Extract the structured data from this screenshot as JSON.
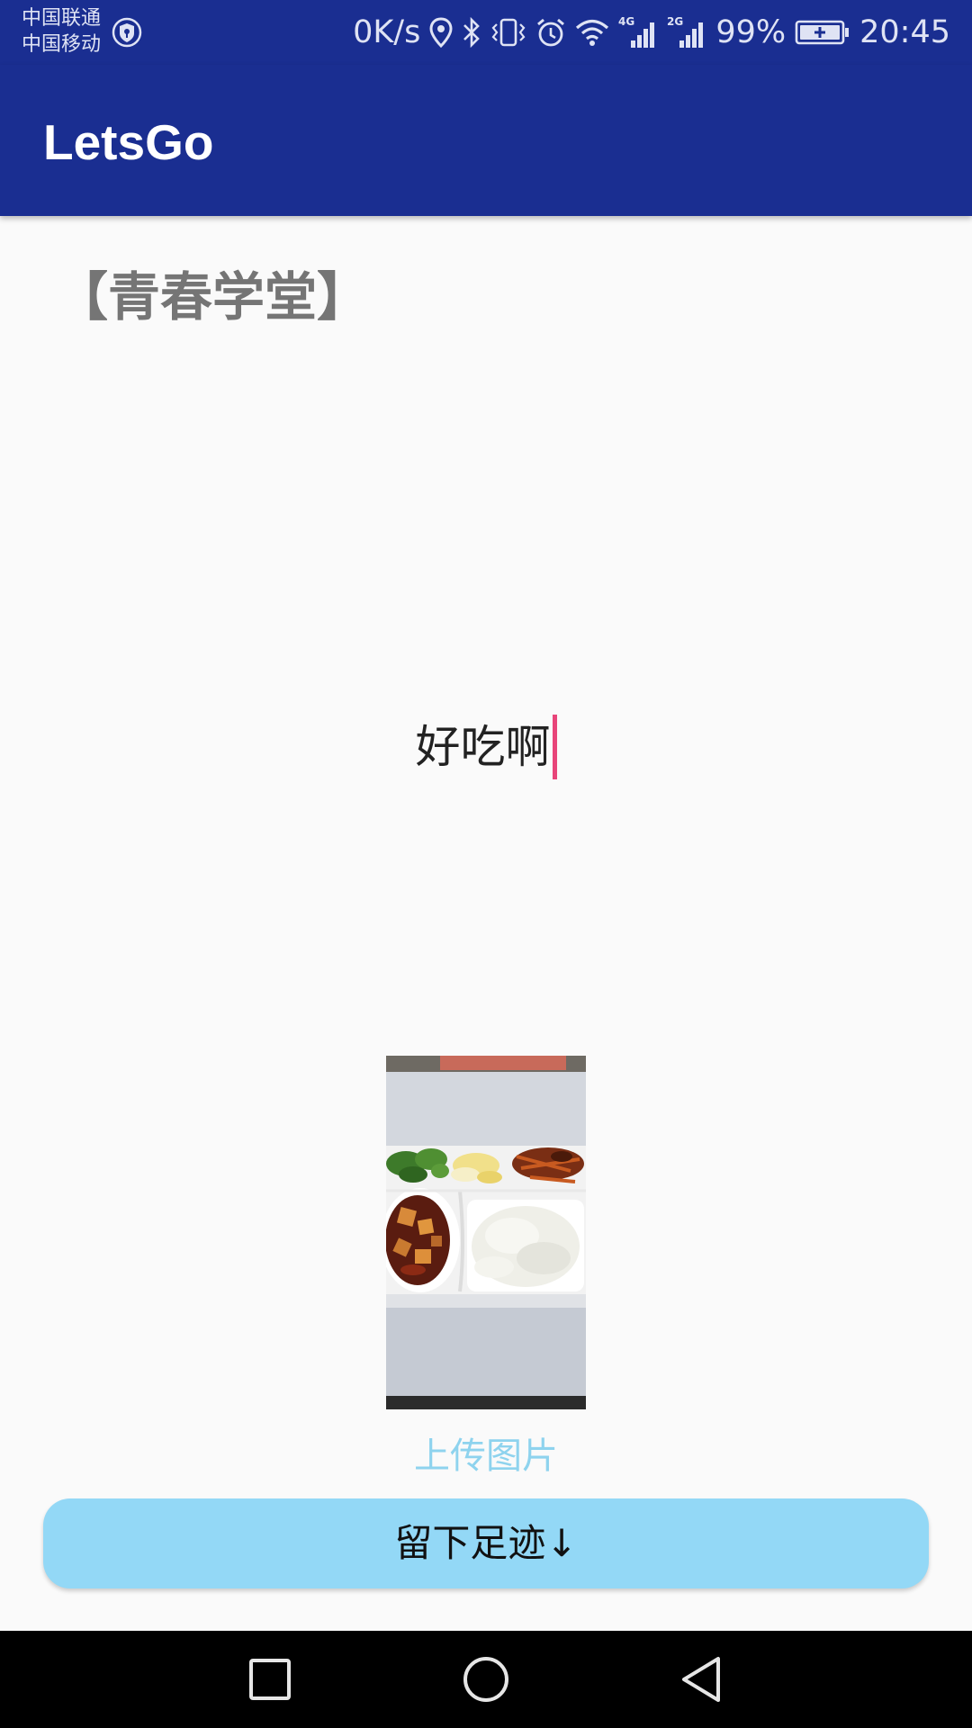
{
  "status_bar": {
    "carrier_1": "中国联通",
    "carrier_2": "中国移动",
    "net_speed": "0K/s",
    "signal_1_label": "4G",
    "signal_2_label": "2G",
    "battery_percent": "99%",
    "time": "20:45",
    "icons": [
      "shield-icon",
      "location-icon",
      "bluetooth-icon",
      "vibrate-icon",
      "alarm-icon",
      "wifi-icon",
      "signal-icon",
      "battery-charging-icon"
    ]
  },
  "app_bar": {
    "title": "LetsGo"
  },
  "place": {
    "title": "【青春学堂】"
  },
  "comment": {
    "value": "好吃啊"
  },
  "photo": {
    "description_icon": "food-photo"
  },
  "upload": {
    "label": "上传图片"
  },
  "submit": {
    "label": "留下足迹↓"
  },
  "nav_bar": {
    "icons": [
      "recents-icon",
      "home-icon",
      "back-icon"
    ]
  },
  "colors": {
    "primary": "#1a2e91",
    "accent": "#e8457a",
    "button": "#93d8f6",
    "link": "#8ed3ee",
    "title_gray": "#757575"
  }
}
